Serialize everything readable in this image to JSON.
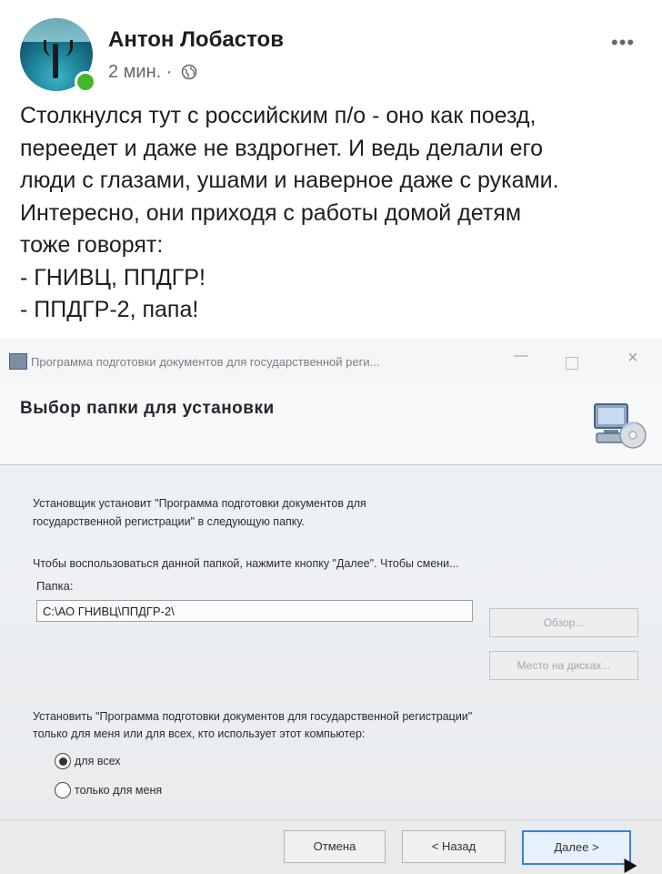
{
  "post": {
    "author": "Антон Лобастов",
    "time": "2 мин. ·",
    "more": "•••",
    "text_lines": [
      "Столкнулся тут с российским п/о - оно как поезд,",
      "переедет и даже не вздрогнет. И ведь делали его",
      "люди с глазами, ушами и наверное даже с руками.",
      "Интересно, они приходя с работы домой детям",
      "тоже говорят:",
      "- ГНИВЦ, ППДГР!",
      "- ППДГР-2, папа!"
    ]
  },
  "window": {
    "title": "Программа подготовки документов для государственной реги...",
    "heading": "Выбор папки для установки",
    "line1": "Установщик установит \"Программа подготовки документов для",
    "line2": "государственной регистрации\" в следующую папку.",
    "line3": "Чтобы воспользоваться данной папкой, нажмите кнопку \"Далее\". Чтобы смени...",
    "folder_label": "Папка:",
    "folder_value": "C:\\АО ГНИВЦ\\ППДГР-2\\",
    "browse_label": "Обзор...",
    "disk_label": "Место на дисках...",
    "install_for_line1": "Установить \"Программа подготовки документов для государственной регистрации\"",
    "install_for_line2": "только для меня или для всех, кто использует этот компьютер:",
    "radio_all": "для всех",
    "radio_me": "только для меня",
    "selected_option": "для всех",
    "cancel_label": "Отмена",
    "back_label": "< Назад",
    "next_label": "Далее >"
  },
  "colors": {
    "online": "#42b72a",
    "accent_button_border": "#3c82d4"
  }
}
